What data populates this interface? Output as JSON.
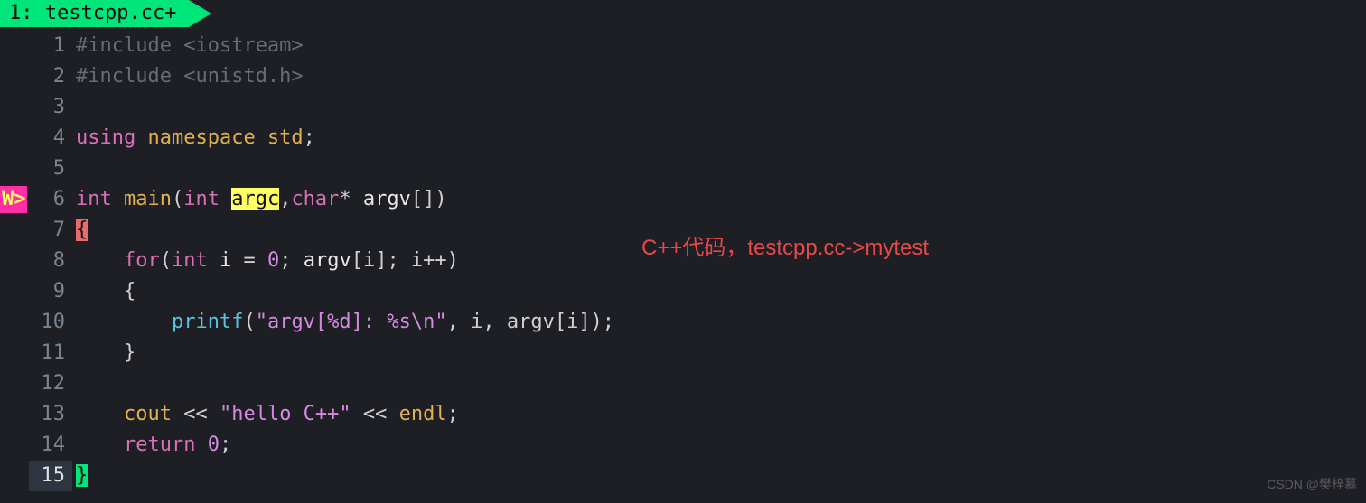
{
  "tab": {
    "label": "1: testcpp.cc+"
  },
  "gutter_warning": "W>",
  "annotation": "C++代码，testcpp.cc->mytest",
  "watermark": "CSDN @樊梓慕",
  "lines": {
    "n1": "1",
    "n2": "2",
    "n3": "3",
    "n4": "4",
    "n5": "5",
    "n6": "6",
    "n7": "7",
    "n8": "8",
    "n9": "9",
    "n10": "10",
    "n11": "11",
    "n12": "12",
    "n13": "13",
    "n14": "14",
    "n15": "15"
  },
  "code": {
    "l1_include": "#include ",
    "l1_path": "<iostream>",
    "l2_include": "#include ",
    "l2_path": "<unistd.h>",
    "l4_using": "using",
    "l4_namespace": " namespace",
    "l4_std": " std",
    "l4_semi": ";",
    "l6_int": "int ",
    "l6_main": "main",
    "l6_open": "(",
    "l6_int2": "int ",
    "l6_argc": "argc",
    "l6_comma": ",",
    "l6_char": "char",
    "l6_star": "* ",
    "l6_argv": "argv",
    "l6_brkt": "[])",
    "l7_brace": "{",
    "l8_indent": "    ",
    "l8_for": "for",
    "l8_open": "(",
    "l8_int": "int ",
    "l8_i": "i ",
    "l8_eq": "= ",
    "l8_zero": "0",
    "l8_semi1": "; ",
    "l8_argv": "argv",
    "l8_brkt": "[i]; i++)",
    "l9_indent": "    ",
    "l9_brace": "{",
    "l10_indent": "        ",
    "l10_printf": "printf",
    "l10_open": "(",
    "l10_str": "\"argv[%d]: %s\\n\"",
    "l10_rest": ", i, argv[i]);",
    "l11_indent": "    ",
    "l11_brace": "}",
    "l13_indent": "    ",
    "l13_cout": "cout ",
    "l13_op1": "<< ",
    "l13_str": "\"hello C++\"",
    "l13_op2": " << ",
    "l13_endl": "endl",
    "l13_semi": ";",
    "l14_indent": "    ",
    "l14_return": "return ",
    "l14_zero": "0",
    "l14_semi": ";",
    "l15_brace": "}"
  }
}
